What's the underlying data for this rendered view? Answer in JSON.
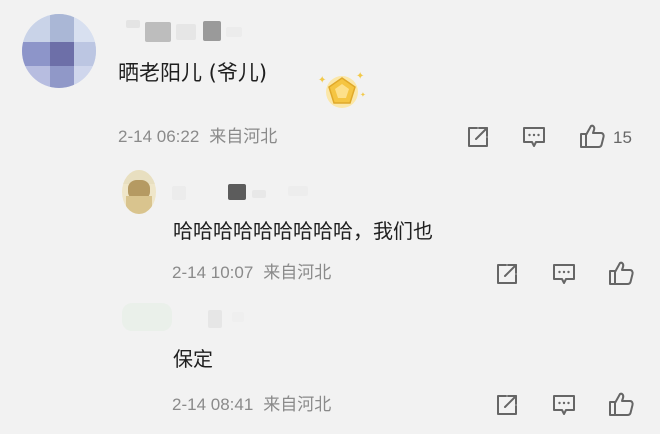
{
  "comments": [
    {
      "text": "晒老阳儿 (爷儿)",
      "time": "2-14 06:22",
      "location": "来自河北",
      "likes": "15",
      "badge_icon": "gold-pentagon-badge-icon"
    },
    {
      "text": "哈哈哈哈哈哈哈哈哈，我们也",
      "time": "2-14 10:07",
      "location": "来自河北"
    },
    {
      "text": "保定",
      "time": "2-14 08:41",
      "location": "来自河北"
    }
  ],
  "icons": {
    "share": "share-icon",
    "comment": "comment-icon",
    "like": "thumbs-up-icon"
  },
  "colors": {
    "background": "#f2f2f2",
    "text": "#1f1f1f",
    "meta": "#8a8a8a",
    "icon": "#666666",
    "badge": "#f5c542"
  }
}
